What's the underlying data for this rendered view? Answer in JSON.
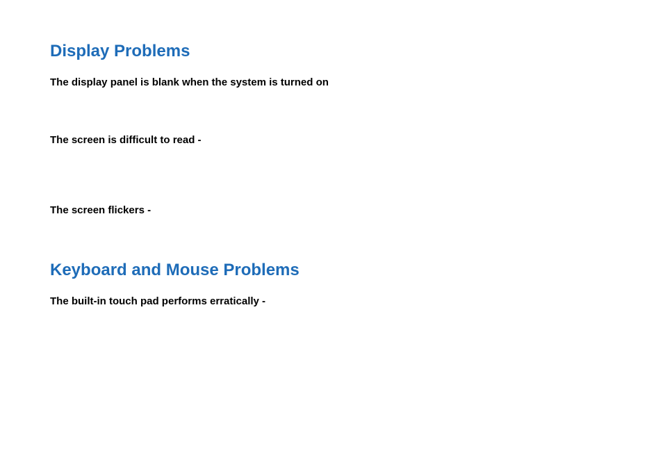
{
  "sections": [
    {
      "heading": "Display Problems",
      "items": [
        "The display panel is blank when the system is turned on",
        "The screen is difficult to read -",
        "The screen flickers -"
      ]
    },
    {
      "heading": "Keyboard and Mouse Problems",
      "items": [
        "The built-in touch pad performs erratically -"
      ]
    }
  ]
}
